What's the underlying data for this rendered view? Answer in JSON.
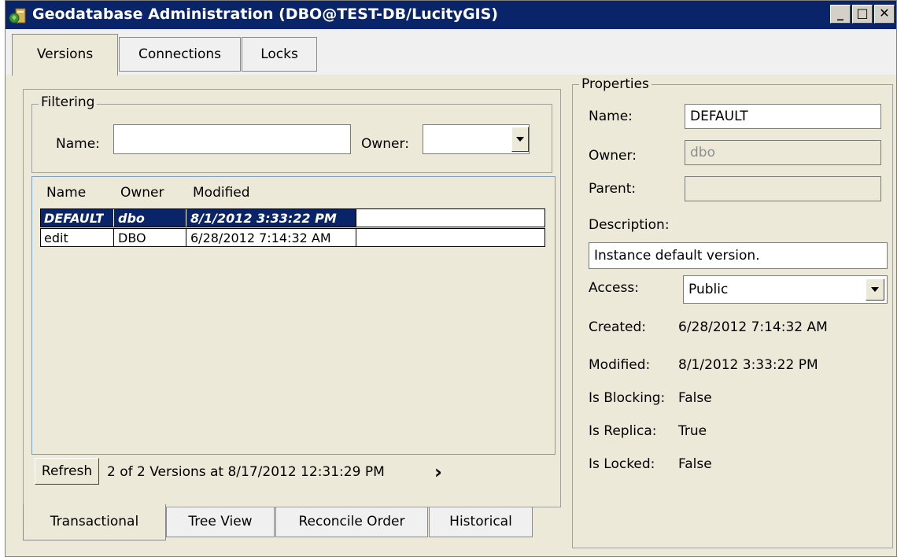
{
  "window": {
    "title": "Geodatabase Administration (DBO@TEST-DB/LucityGIS)",
    "minimize_glyph": "_",
    "maximize_glyph": "□",
    "close_glyph": "✕"
  },
  "top_tabs": [
    "Versions",
    "Connections",
    "Locks"
  ],
  "filtering": {
    "group_label": "Filtering",
    "name_label": "Name:",
    "name_value": "",
    "owner_label": "Owner:",
    "owner_value": ""
  },
  "versions_list": {
    "columns": [
      "Name",
      "Owner",
      "Modified"
    ],
    "rows": [
      {
        "name": "DEFAULT",
        "owner": "dbo",
        "modified": "8/1/2012 3:33:22 PM",
        "selected": true
      },
      {
        "name": "edit",
        "owner": "DBO",
        "modified": "6/28/2012 7:14:32 AM",
        "selected": false
      }
    ]
  },
  "footer": {
    "refresh_label": "Refresh",
    "status_text": "2 of 2 Versions at 8/17/2012 12:31:29 PM",
    "more_glyph": "›"
  },
  "bottom_tabs": [
    "Transactional",
    "Tree View",
    "Reconcile Order",
    "Historical"
  ],
  "properties": {
    "group_label": "Properties",
    "name_label": "Name:",
    "name_value": "DEFAULT",
    "owner_label": "Owner:",
    "owner_value": "dbo",
    "parent_label": "Parent:",
    "parent_value": "",
    "description_label": "Description:",
    "description_value": "Instance default version.",
    "access_label": "Access:",
    "access_value": "Public",
    "created_label": "Created:",
    "created_value": "6/28/2012 7:14:32 AM",
    "modified_label": "Modified:",
    "modified_value": "8/1/2012 3:33:22 PM",
    "is_blocking_label": "Is Blocking:",
    "is_blocking_value": "False",
    "is_replica_label": "Is Replica:",
    "is_replica_value": "True",
    "is_locked_label": "Is Locked:",
    "is_locked_value": "False"
  },
  "colors": {
    "title_bar": "#0a246a",
    "selection": "#0a246a",
    "face": "#ece9d8"
  },
  "icons": [
    "app-geodatabase-icon",
    "dropdown-arrow-icon",
    "chevron-right-icon"
  ]
}
